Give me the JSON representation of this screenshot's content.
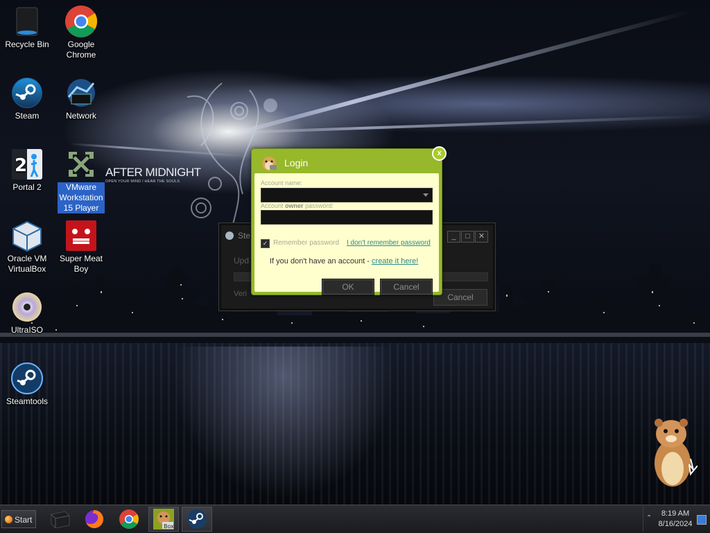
{
  "desktop": {
    "icons": [
      {
        "label": "Recycle Bin"
      },
      {
        "label": "Google Chrome"
      },
      {
        "label": "Steam"
      },
      {
        "label": "Network"
      },
      {
        "label": "Portal 2"
      },
      {
        "label": "VMware Workstation 15 Player"
      },
      {
        "label": "Oracle VM VirtualBox"
      },
      {
        "label": "Super Meat Boy"
      },
      {
        "label": "UltraISO"
      },
      {
        "label": "Steamtools"
      }
    ],
    "wallpaper_text": {
      "title": "AFTER MIDNIGHT",
      "subtitle": "OPEN YOUR MIND / HEAR THE SOULS"
    }
  },
  "steam_window": {
    "title": "Ste",
    "update_label": "Upd",
    "verify_label": "Veri",
    "cancel_label": "Cancel"
  },
  "login_dialog": {
    "title": "Login",
    "close_label": "x",
    "account_name_label": "Account name:",
    "password_label_pre": "Account ",
    "password_label_bold": "owner",
    "password_label_post": " password:",
    "remember_label": "Remember password",
    "remember_checked": true,
    "forgot_link": "I don't remember password",
    "no_account_text": "If you don't have an account - ",
    "create_link": "create it here!",
    "ok_label": "OK",
    "cancel_label": "Cancel",
    "accent_color": "#97b82a",
    "body_color": "#ffffce"
  },
  "taskbar": {
    "start_label": "Start",
    "pinned": [
      {
        "icon": "terminal-icon"
      },
      {
        "icon": "firefox-icon"
      },
      {
        "icon": "chrome-icon"
      },
      {
        "icon": "box-hamster-icon",
        "label": "Box"
      },
      {
        "icon": "steam-icon"
      }
    ],
    "clock_time": "8:19 AM",
    "clock_date": "8/16/2024"
  }
}
